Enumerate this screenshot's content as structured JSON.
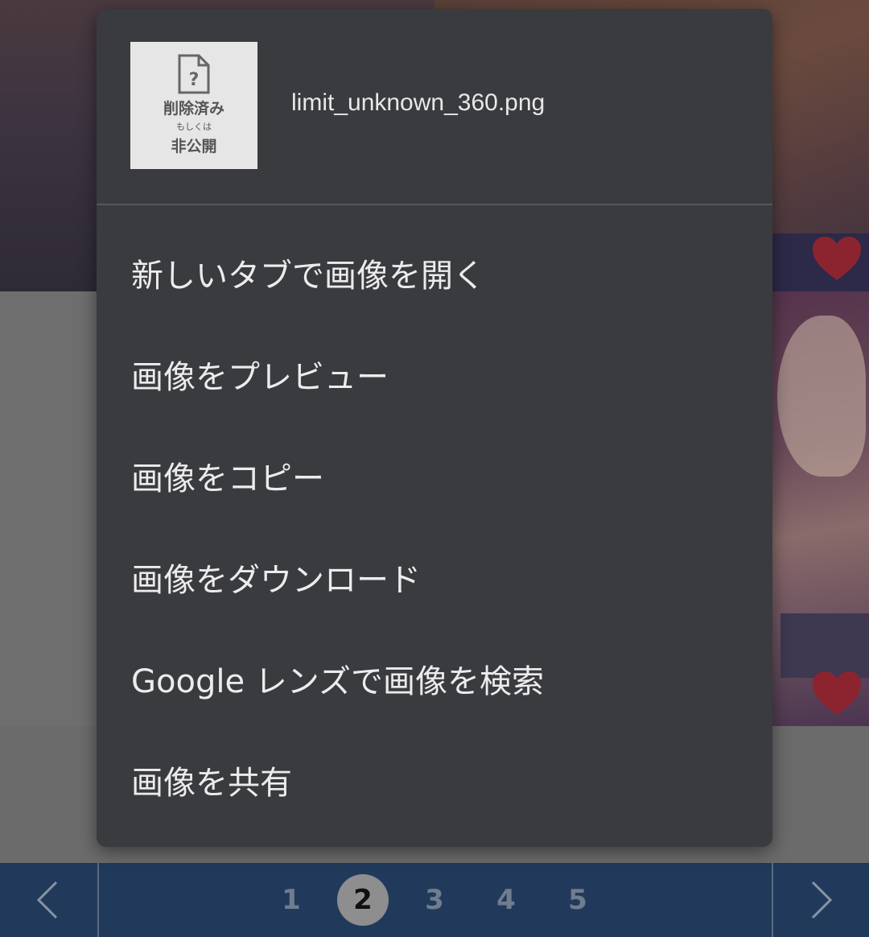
{
  "context_menu": {
    "thumbnail": {
      "line1": "削除済み",
      "line2": "もしくは",
      "line3": "非公開"
    },
    "filename": "limit_unknown_360.png",
    "items": [
      {
        "label": "新しいタブで画像を開く"
      },
      {
        "label": "画像をプレビュー"
      },
      {
        "label": "画像をコピー"
      },
      {
        "label": "画像をダウンロード"
      },
      {
        "label": "Google レンズで画像を検索"
      },
      {
        "label": "画像を共有"
      }
    ]
  },
  "pager": {
    "pages": [
      "1",
      "2",
      "3",
      "4",
      "5"
    ],
    "current_page": "2",
    "prev_icon": "chevron-left-icon",
    "next_icon": "chevron-right-icon"
  },
  "colors": {
    "menu_bg": "#3a3b3f",
    "pager_bg": "#213a5c",
    "heart": "#b0283a"
  }
}
